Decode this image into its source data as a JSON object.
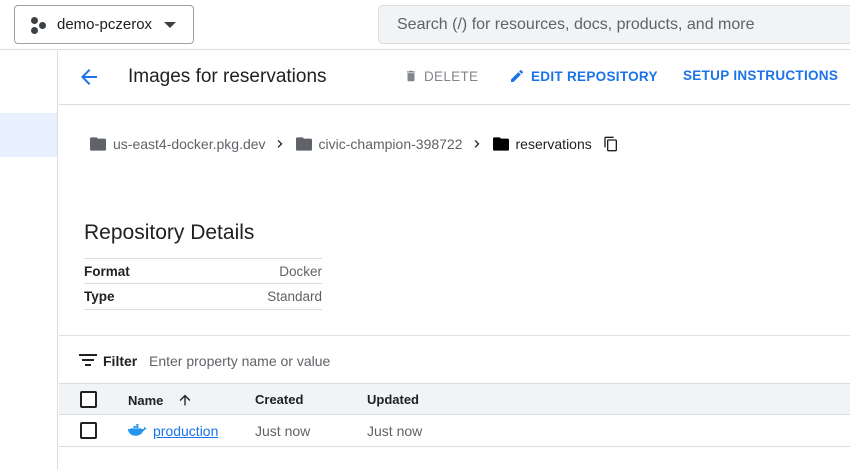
{
  "topbar": {
    "project_name": "demo-pczerox",
    "search_placeholder": "Search (/) for resources, docs, products, and more"
  },
  "header": {
    "title": "Images for reservations",
    "delete_label": "DELETE",
    "edit_label": "EDIT REPOSITORY",
    "setup_label": "SETUP INSTRUCTIONS"
  },
  "breadcrumb": [
    {
      "label": "us-east4-docker.pkg.dev"
    },
    {
      "label": "civic-champion-398722"
    },
    {
      "label": "reservations"
    }
  ],
  "details": {
    "title": "Repository Details",
    "rows": [
      {
        "key": "Format",
        "value": "Docker"
      },
      {
        "key": "Type",
        "value": "Standard"
      }
    ]
  },
  "filter": {
    "label": "Filter",
    "placeholder": "Enter property name or value"
  },
  "table": {
    "columns": [
      "Name",
      "Created",
      "Updated"
    ],
    "rows": [
      {
        "name": "production",
        "created": "Just now",
        "updated": "Just now"
      }
    ]
  },
  "colors": {
    "accent": "#1a73e8",
    "docker": "#2496ed"
  }
}
